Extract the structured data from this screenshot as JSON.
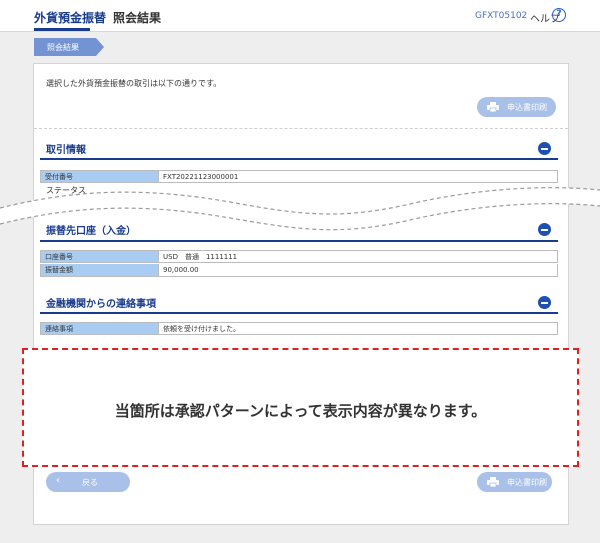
{
  "header": {
    "app_title": "外貨預金振替",
    "screen_title": "照会結果",
    "screen_id": "GFXT05102",
    "help_label": "ヘルプ",
    "help_icon": "question-circle-icon"
  },
  "step": {
    "label": "照会結果"
  },
  "intro_text": "選択した外貨預金振替の取引は以下の通りです。",
  "print_button": "申込書印刷",
  "sections": {
    "transaction": {
      "title": "取引情報",
      "rows": [
        {
          "key": "受付番号",
          "value": "FXT20221123000001"
        },
        {
          "key": "ステータス",
          "value": ""
        }
      ]
    },
    "destination": {
      "title": "振替先口座（入金）",
      "rows": [
        {
          "key": "口座番号",
          "value": "USD　普通　1111111"
        },
        {
          "key": "振替金額",
          "value": "90,000.00"
        }
      ]
    },
    "bank_notice": {
      "title": "金融機関からの連絡事項",
      "rows": [
        {
          "key": "連絡事項",
          "value": "依頼を受け付けました。"
        }
      ]
    }
  },
  "note": "当箇所は承認パターンによって表示内容が異なります。",
  "footer": {
    "back_label": "戻る",
    "print_label": "申込書印刷"
  },
  "colors": {
    "brand": "#1a3c8c",
    "button": "#a9c0e8",
    "table_key_bg": "#a9cdf2",
    "note_border": "#e02020"
  }
}
